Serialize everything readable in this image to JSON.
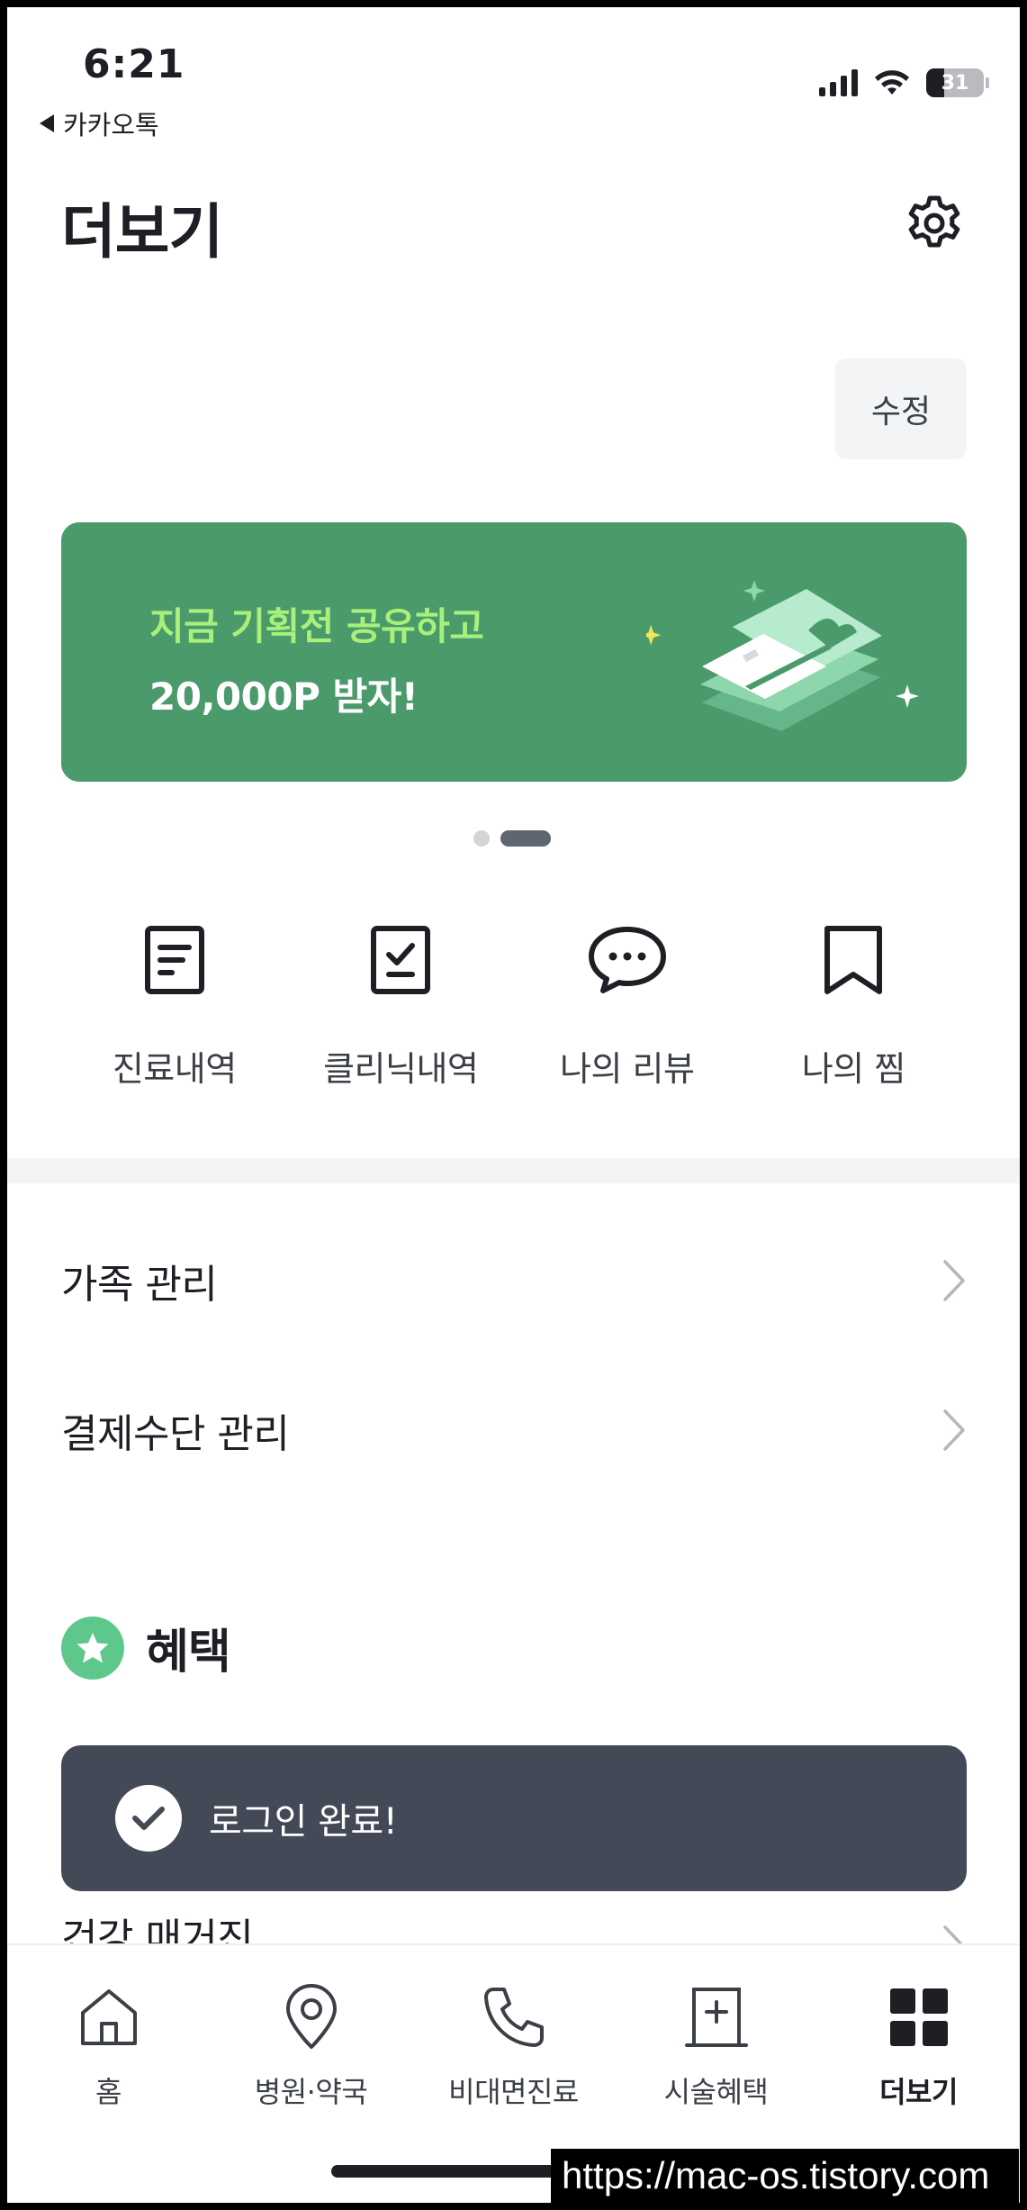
{
  "status_bar": {
    "time": "6:21",
    "back_app": "카카오톡",
    "battery": "31"
  },
  "header": {
    "title": "더보기",
    "edit_label": "수정"
  },
  "banner": {
    "line1": "지금 기획전 공유하고",
    "line2": "20,000P 받자!",
    "page_count": 2,
    "active_page": 2,
    "colors": {
      "background": "#4a9a6c",
      "highlight": "#a8f07a"
    }
  },
  "quick_menu": [
    {
      "label": "진료내역",
      "icon": "document-icon"
    },
    {
      "label": "클리닉내역",
      "icon": "checklist-icon"
    },
    {
      "label": "나의 리뷰",
      "icon": "chat-bubble-icon"
    },
    {
      "label": "나의 찜",
      "icon": "bookmark-icon"
    }
  ],
  "menu_rows": [
    {
      "label": "가족 관리"
    },
    {
      "label": "결제수단 관리"
    }
  ],
  "benefits": {
    "title": "혜택",
    "icon": "star-icon",
    "first_item": "건강 매거진"
  },
  "toast": {
    "text": "로그인 완료!"
  },
  "tabbar": {
    "tabs": [
      {
        "label": "홈",
        "icon": "home-icon"
      },
      {
        "label": "병원·약국",
        "icon": "location-pin-icon"
      },
      {
        "label": "비대면진료",
        "icon": "phone-icon"
      },
      {
        "label": "시술혜택",
        "icon": "medical-cross-icon"
      },
      {
        "label": "더보기",
        "icon": "grid-icon",
        "active": true
      }
    ]
  },
  "watermark": "https://mac-os.tistory.com"
}
